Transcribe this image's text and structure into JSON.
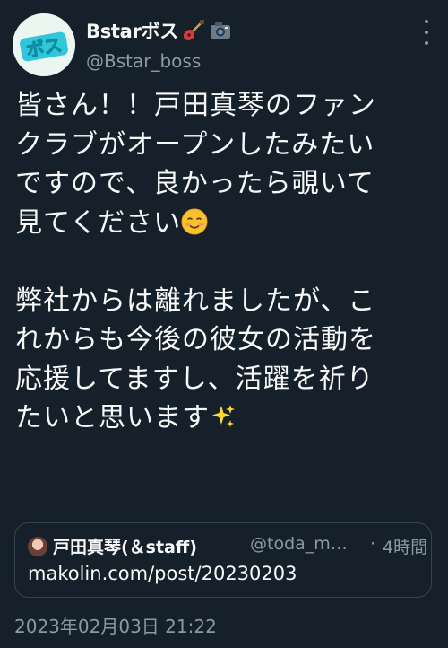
{
  "author": {
    "display_name": "Bstarボス",
    "handle": "@Bstar_boss",
    "avatar_text": "ボス",
    "name_emoji": [
      "guitar-icon",
      "camera-icon"
    ]
  },
  "tweet": {
    "lines_1": [
      "皆さん！！戸田真琴のファン",
      "クラブがオープンしたみたい",
      "ですので、良かったら覗いて",
      "見てください"
    ],
    "lines_2": [
      "弊社からは離れましたが、こ",
      "れからも今後の彼女の活動を",
      "応援してますし、活躍を祈り",
      "たいと思います"
    ],
    "emoji_1": "smiling-face-icon",
    "emoji_2": "sparkles-icon"
  },
  "quote": {
    "name": "戸田真琴(＆staff)",
    "handle": "@toda_m…",
    "separator": "·",
    "time": "4時間",
    "text": "makolin.com/post/20230203"
  },
  "timestamp": "2023年02月03日 21:22",
  "colors": {
    "background": "#15202b",
    "text": "#f7f9f9",
    "muted": "#8b98a5",
    "border": "#38444d"
  }
}
